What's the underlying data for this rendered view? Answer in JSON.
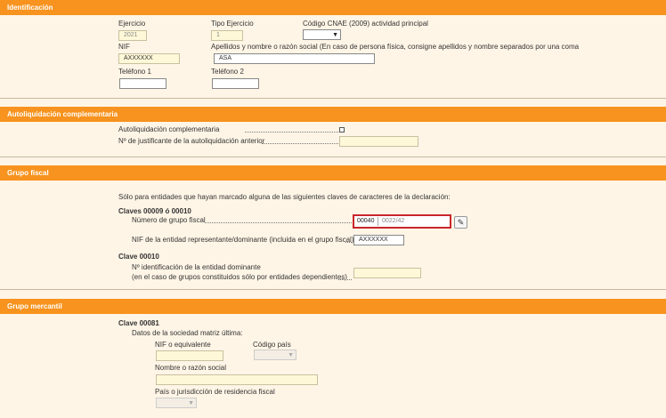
{
  "identificacion": {
    "header": "Identificación",
    "ejercicio_label": "Ejercicio",
    "ejercicio_value": "2021",
    "tipo_ejercicio_label": "Tipo Ejercicio",
    "tipo_ejercicio_value": "1",
    "cnae_label": "Código CNAE (2009) actividad principal",
    "nif_label": "NIF",
    "nif_value": "AXXXXXX",
    "apellidos_label": "Apellidos y nombre o razón social (En caso de persona física, consigne apellidos y nombre separados por una coma",
    "apellidos_value": "ASA",
    "telefono1_label": "Teléfono 1",
    "telefono2_label": "Teléfono 2"
  },
  "autoliquidacion": {
    "header": "Autoliquidación complementaria",
    "complementaria_label": "Autoliquidación complementaria",
    "justificante_label": "Nº de justificante de la autoliquidación anterior"
  },
  "grupo_fiscal": {
    "header": "Grupo fiscal",
    "intro": "Sólo para entidades que hayan marcado alguna de las siguientes claves de caracteres de la declaración:",
    "claves_label": "Claves 00009 ó 00010",
    "numero_label": "Número de grupo fiscal",
    "numero_part1": "00040",
    "numero_part2": "0022/42",
    "nif_rep_label": "NIF de la entidad representante/dominante (incluida en el grupo fiscal)",
    "nif_rep_value": "AXXXXXX",
    "clave_00010_label": "Clave 00010",
    "id_dominante_label1": "Nº identificación de la entidad dominante",
    "id_dominante_label2": "(en el caso de grupos constituidos sólo por entidades dependientes)"
  },
  "grupo_mercantil": {
    "header": "Grupo mercantil",
    "clave_label": "Clave 00081",
    "datos_label": "Datos de la sociedad matriz última:",
    "nif_equiv_label": "NIF o equivalente",
    "codigo_pais_label": "Código país",
    "nombre_label": "Nombre o razón social",
    "pais_label": "País o jurisdicción de residencia fiscal"
  },
  "icons": {
    "dropdown": "chevron-down-icon",
    "edit": "pencil-icon"
  },
  "colors": {
    "header_bg": "#f7931e",
    "page_bg": "#fff5e6",
    "highlight_border": "#c9262b"
  }
}
